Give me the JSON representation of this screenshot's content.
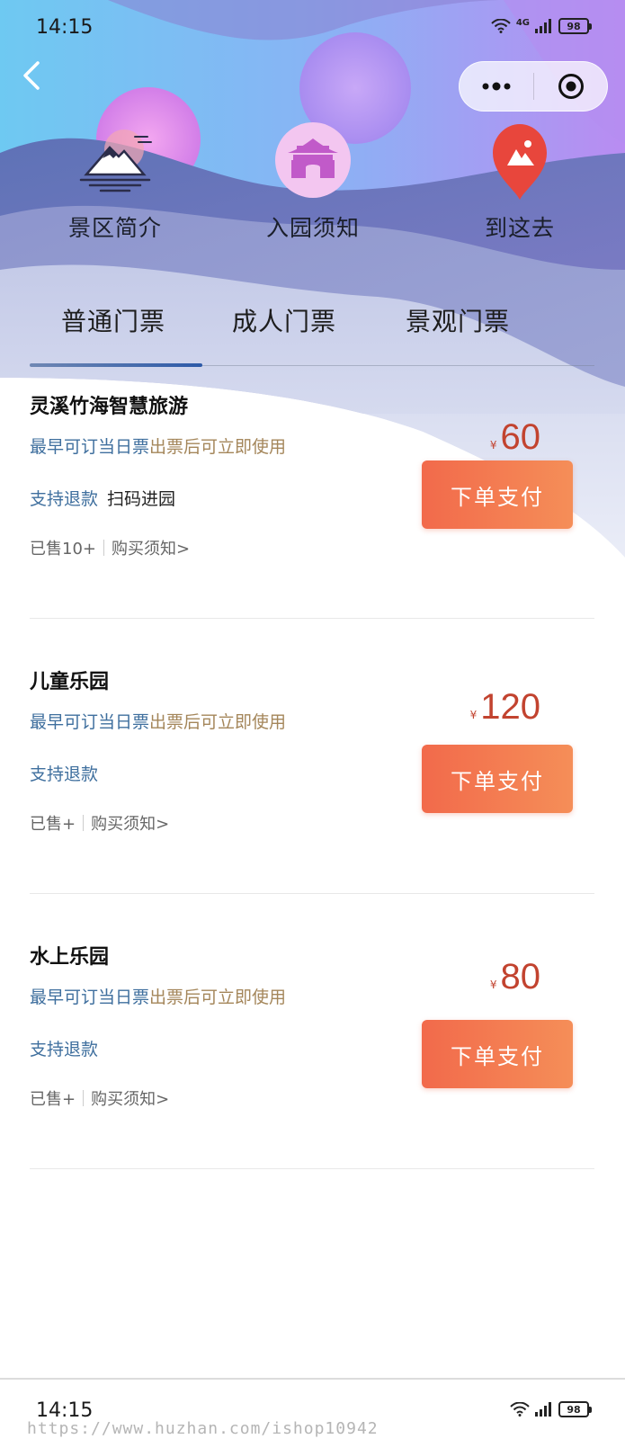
{
  "status_bar": {
    "time": "14:15",
    "network": "4G",
    "battery": "98"
  },
  "nav": {
    "back_icon": "chevron-left-icon",
    "more_icon": "more-dots-icon",
    "close_icon": "target-icon"
  },
  "features": [
    {
      "label": "景区简介",
      "icon": "mountain-sun-icon"
    },
    {
      "label": "入园须知",
      "icon": "gate-pavilion-icon"
    },
    {
      "label": "到这去",
      "icon": "map-pin-icon"
    }
  ],
  "tabs": [
    {
      "label": "普通门票",
      "active": true
    },
    {
      "label": "成人门票",
      "active": false
    },
    {
      "label": "景观门票",
      "active": false
    }
  ],
  "tickets": [
    {
      "name": "灵溪竹海智慧旅游",
      "book": "最早可订当日票",
      "use": "出票后可立即使用",
      "refund": "支持退款",
      "scan": "扫码进园",
      "sold": "已售10+",
      "notice": "购买须知>",
      "currency": "¥",
      "price": "60",
      "pay": "下单支付"
    },
    {
      "name": "儿童乐园",
      "book": "最早可订当日票",
      "use": "出票后可立即使用",
      "refund": "支持退款",
      "scan": "",
      "sold": "已售+",
      "notice": "购买须知>",
      "currency": "¥",
      "price": "120",
      "pay": "下单支付"
    },
    {
      "name": "水上乐园",
      "book": "最早可订当日票",
      "use": "出票后可立即使用",
      "refund": "支持退款",
      "scan": "",
      "sold": "已售+",
      "notice": "购买须知>",
      "currency": "¥",
      "price": "80",
      "pay": "下单支付"
    }
  ],
  "bottom": {
    "time": "14:15",
    "battery": "98",
    "watermark": "https://www.huzhan.com/ishop10942"
  },
  "colors": {
    "accent": "#2d5aa8",
    "price": "#c2432f",
    "button": "#f26a4b",
    "book_text": "#3f6f9e",
    "use_text": "#a4865a"
  }
}
